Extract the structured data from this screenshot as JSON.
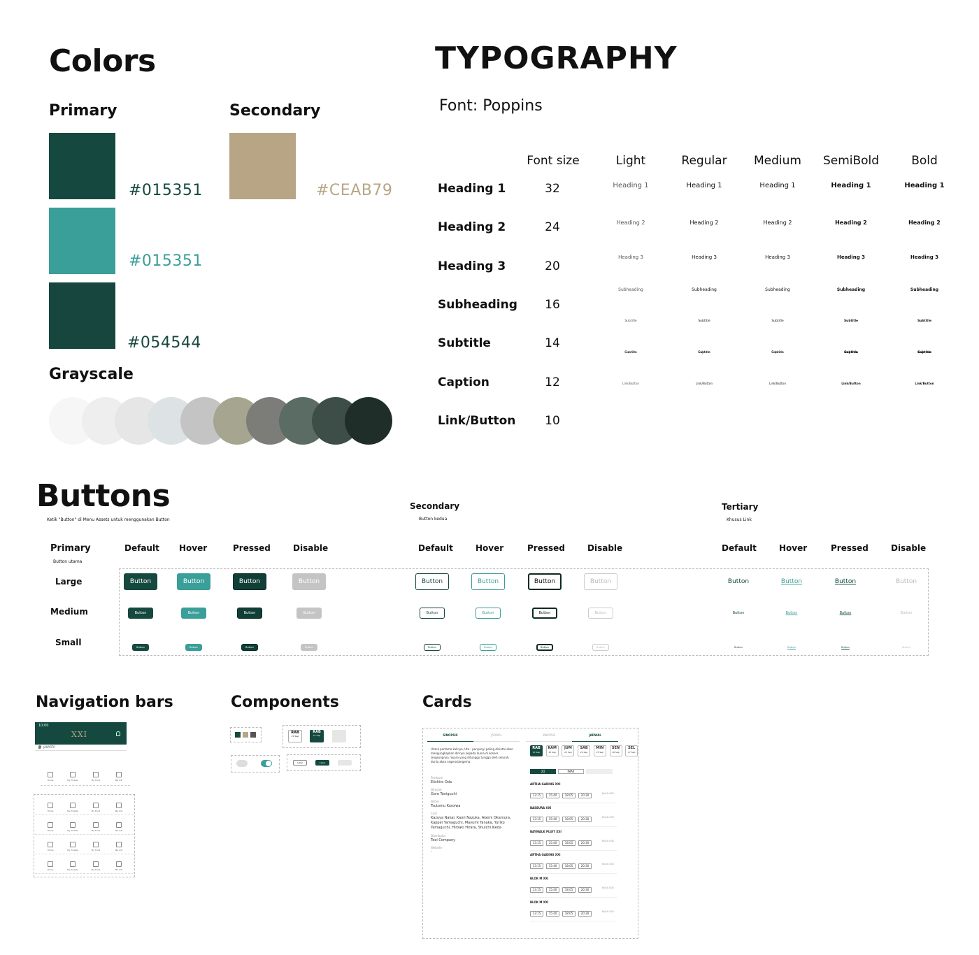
{
  "colors": {
    "title": "Colors",
    "primary_label": "Primary",
    "secondary_label": "Secondary",
    "grayscale_label": "Grayscale",
    "primary": [
      {
        "hex_label": "#015351",
        "color": "#15493f"
      },
      {
        "hex_label": "#015351",
        "color": "#3a9e99"
      },
      {
        "hex_label": "#054544",
        "color": "#16463e"
      }
    ],
    "secondary": [
      {
        "hex_label": "#CEAB79",
        "color": "#b8a585"
      }
    ],
    "grayscale": [
      "#f6f6f6",
      "#eeeeee",
      "#e6e6e6",
      "#dde2e5",
      "#c4c4c4",
      "#a5a590",
      "#7c7c78",
      "#5a6c64",
      "#3d4e48",
      "#1f2e29"
    ]
  },
  "typography": {
    "title": "TYPOGRAPHY",
    "font_line": "Font: Poppins",
    "font_size_header": "Font size",
    "weights": [
      "Light",
      "Regular",
      "Medium",
      "SemiBold",
      "Bold"
    ],
    "rows": [
      {
        "name": "Heading 1",
        "size": "32"
      },
      {
        "name": "Heading 2",
        "size": "24"
      },
      {
        "name": "Heading 3",
        "size": "20"
      },
      {
        "name": "Subheading",
        "size": "16"
      },
      {
        "name": "Subtitle",
        "size": "14"
      },
      {
        "name": "Caption",
        "size": "12"
      },
      {
        "name": "Link/Button",
        "size": "10"
      }
    ]
  },
  "buttons": {
    "title": "Buttons",
    "subtitle": "Ketik \"Button\" di Menu Assets untuk menggunakan Button",
    "primary": {
      "label": "Primary",
      "sub": "Button utama"
    },
    "secondary": {
      "label": "Secondary",
      "sub": "Button kedua"
    },
    "tertiary": {
      "label": "Tertiary",
      "sub": "Khusus Link"
    },
    "states": [
      "Default",
      "Hover",
      "Pressed",
      "Disable"
    ],
    "sizes": [
      "Large",
      "Medium",
      "Small"
    ],
    "button_text": "Button"
  },
  "navigation": {
    "title": "Navigation bars",
    "phone_time": "10:00",
    "phone_logo": "XXI",
    "location": "JAKARTA",
    "tab_items": [
      "Home",
      "My Tickets",
      "My Food",
      "Me XXI"
    ]
  },
  "components": {
    "title": "Components",
    "date_chip_day": "RAB",
    "date_chip_date": "21 Sep",
    "label_text": "Label"
  },
  "cards": {
    "title": "Cards",
    "tabs": [
      "SINOPSIS",
      "JADWAL"
    ],
    "synopsis": "Untuk pertama kalinya, Uta - penyanyi paling dicintai akan mengungkapkan dirinya kepada dunia di konser langsungnya. Suara yang ditunggu tunggu oleh seluruh dunia akan segera bergema.",
    "credits": [
      {
        "label": "Producer",
        "value": "Eiichiro Oda"
      },
      {
        "label": "Director",
        "value": "Goro Taniguchi"
      },
      {
        "label": "Writer",
        "value": "Tsutomu Kuroiwa"
      },
      {
        "label": "Cast",
        "value": "Kazuya Nakai, Kaori Nazuka, Akemi Okamura, Kappei Yamaguchi, Mayumi Tanaka, Yuriko Yamaguchi, Hiroaki Hirata, Shuichi Ikeda"
      },
      {
        "label": "Distributor",
        "value": "Toei Company"
      },
      {
        "label": "Website",
        "value": "-"
      }
    ],
    "days": [
      {
        "d": "RAB",
        "date": "21 Sep"
      },
      {
        "d": "KAM",
        "date": "22 Sep"
      },
      {
        "d": "JUM",
        "date": "23 Sep"
      },
      {
        "d": "SAB",
        "date": "24 Sep"
      },
      {
        "d": "MIN",
        "date": "25 Sep"
      },
      {
        "d": "SEN",
        "date": "26 Sep"
      },
      {
        "d": "SEL",
        "date": "27 Sep"
      }
    ],
    "formats": [
      "2D",
      "IMAX"
    ],
    "cinemas": [
      "ARTHA GADING XXI",
      "BASSURA XXI",
      "BAYWALK PLUIT XXI",
      "ARTHA GADING XXI",
      "BLOK M XXI",
      "BLOK M XXI"
    ],
    "times": [
      "13:15",
      "15:40",
      "18:05",
      "20:30"
    ],
    "price": "Rp50.000"
  }
}
